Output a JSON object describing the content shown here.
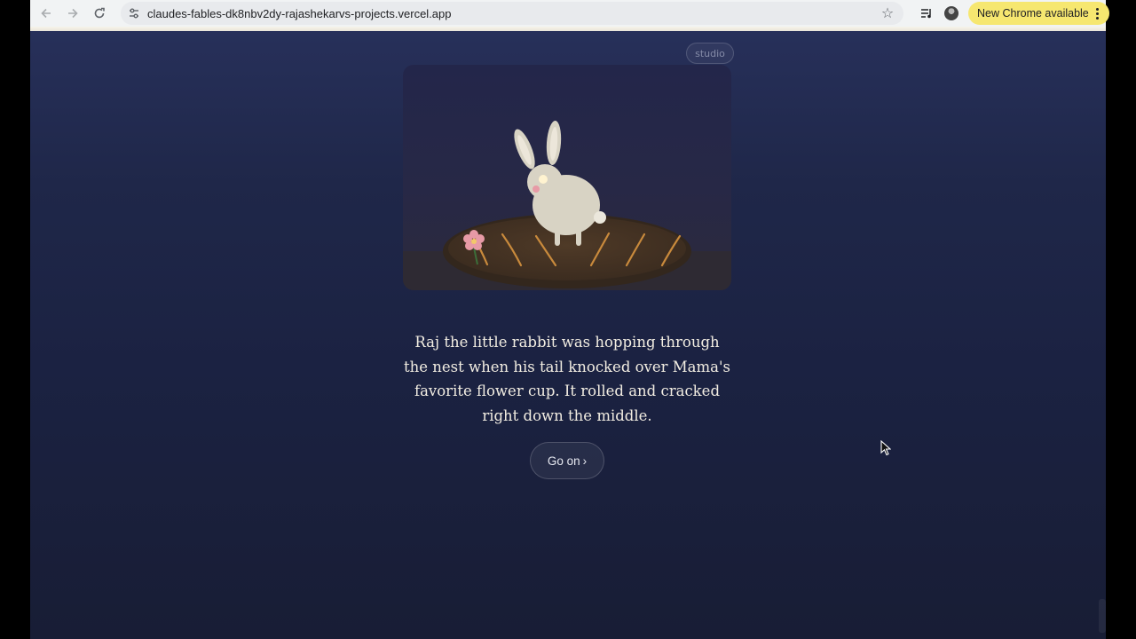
{
  "browser": {
    "url": "claudes-fables-dk8nbv2dy-rajashekarvs-projects.vercel.app",
    "update_chip_label": "New Chrome available",
    "icons": [
      "back-arrow-icon",
      "forward-arrow-icon",
      "reload-icon",
      "site-settings-icon",
      "bookmark-star-icon",
      "media-controls-icon",
      "profile-avatar",
      "more-menu-icon"
    ]
  },
  "page": {
    "studio_label": "studio",
    "story_text": "Raj the little rabbit was hopping through the nest when his tail knocked over Mama's favorite flower cup. It rolled and cracked right down the middle.",
    "go_on_label": "Go on",
    "go_on_chevron": "›"
  },
  "colors": {
    "background_top": "#27305a",
    "background_bottom": "#181d35",
    "text": "#f2ede2",
    "nest": "#4a3624",
    "twigs": "#c98a3c",
    "rabbit": "#d8d3c4",
    "flower": "#e79aa6"
  }
}
